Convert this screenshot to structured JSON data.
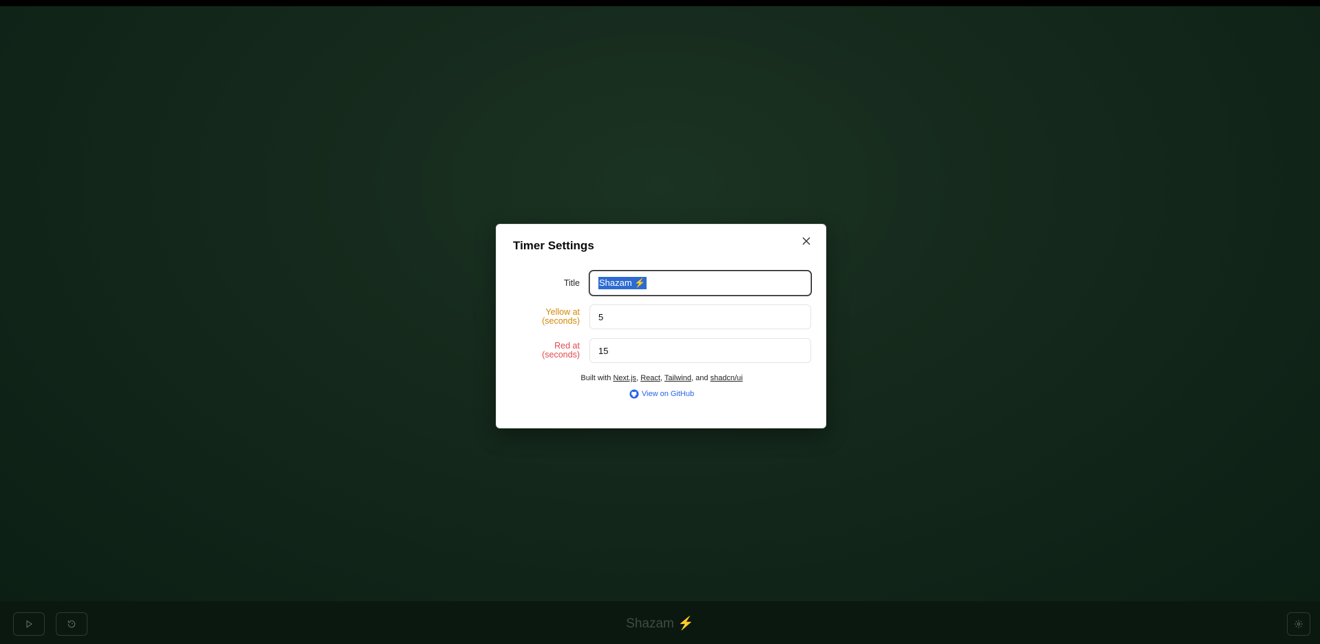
{
  "dialog": {
    "title": "Timer Settings",
    "fields": [
      {
        "label_line1": "Title",
        "label_line2": "",
        "value": "Shazam",
        "value_suffix": "⚡",
        "label_color": "#27272a"
      },
      {
        "label_line1": "Yellow at",
        "label_line2": "(seconds)",
        "value": "5",
        "label_color": "#d48806"
      },
      {
        "label_line1": "Red at",
        "label_line2": "(seconds)",
        "value": "15",
        "label_color": "#e5484d"
      }
    ],
    "footer": {
      "prefix": "Built with ",
      "links": [
        "Next.js",
        "React",
        "Tailwind",
        "shadcn/ui"
      ],
      "sep1": ", ",
      "sep2": ", ",
      "sep3": ", and ",
      "github_label": "View on GitHub"
    }
  },
  "bottombar": {
    "title": "Shazam",
    "title_suffix": "⚡"
  },
  "icons": {
    "close": "close-icon",
    "play": "play-icon",
    "reset": "reset-icon",
    "settings": "gear-icon",
    "github": "github-icon"
  }
}
